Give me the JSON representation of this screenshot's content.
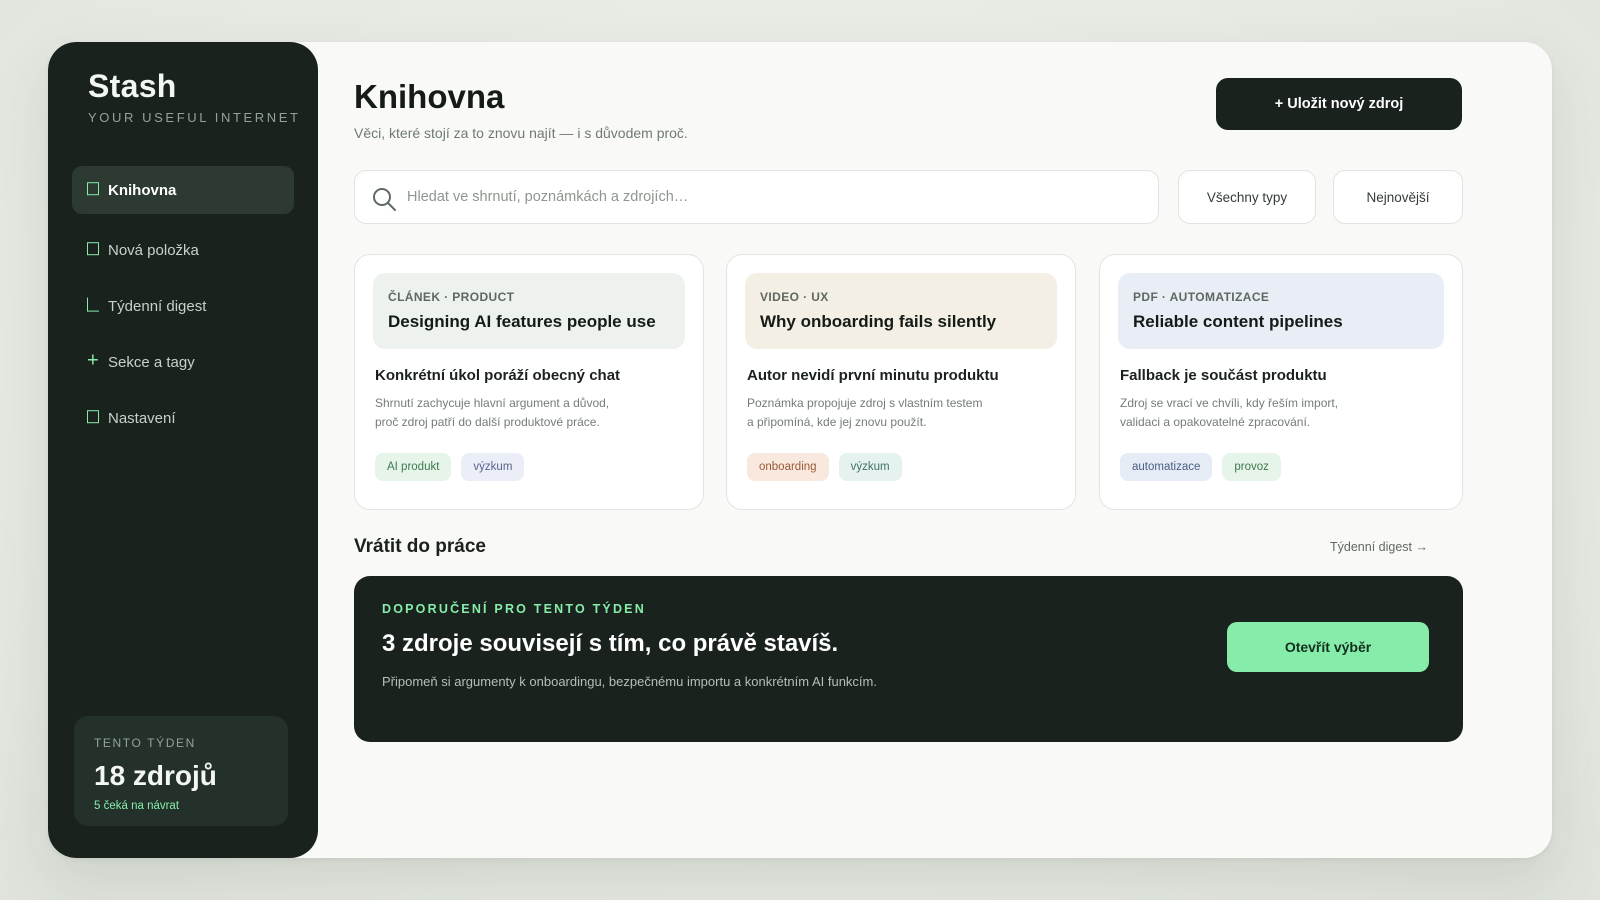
{
  "colors": {
    "accent": "#86ecaa",
    "sidebar_bg": "#1a221e",
    "page_bg": "#f9faf8"
  },
  "sidebar": {
    "brand": "Stash",
    "tagline": "YOUR USEFUL INTERNET",
    "items": [
      {
        "label": "Knihovna",
        "icon": "square-icon",
        "active": true
      },
      {
        "label": "Nová položka",
        "icon": "square-icon",
        "active": false
      },
      {
        "label": "Týdenní digest",
        "icon": "corner-icon",
        "active": false
      },
      {
        "label": "Sekce a tagy",
        "icon": "plus-icon",
        "active": false
      },
      {
        "label": "Nastavení",
        "icon": "square-icon",
        "active": false
      }
    ],
    "week": {
      "label": "TENTO TÝDEN",
      "count": "18 zdrojů",
      "sub": "5 čeká na návrat"
    }
  },
  "header": {
    "title": "Knihovna",
    "subtitle": "Věci, které stojí za to znovu najít — i s důvodem proč.",
    "primary_button": "+ Uložit nový zdroj"
  },
  "search": {
    "placeholder": "Hledat ve shrnutí, poznámkách a zdrojích…",
    "value": "",
    "icon": "search-icon"
  },
  "filters": {
    "type_label": "Všechny typy",
    "sort_label": "Nejnovější"
  },
  "cards": [
    {
      "kicker": "ČLÁNEK · PRODUCT",
      "title": "Designing AI features people use",
      "heading": "Konkrétní úkol poráží obecný chat",
      "body_line1": "Shrnutí zachycuje hlavní argument a důvod,",
      "body_line2": "proč zdroj patří do další produktové práce.",
      "tags": [
        "AI produkt",
        "výzkum"
      ],
      "head_bg": "#eef2ee"
    },
    {
      "kicker": "VIDEO · UX",
      "title": "Why onboarding fails silently",
      "heading": "Autor nevidí první minutu produktu",
      "body_line1": "Poznámka propojuje zdroj s vlastním testem",
      "body_line2": "a připomíná, kde jej znovu použít.",
      "tags": [
        "onboarding",
        "výzkum"
      ],
      "head_bg": "#f3efe4"
    },
    {
      "kicker": "PDF · AUTOMATIZACE",
      "title": "Reliable content pipelines",
      "heading": "Fallback je součást produktu",
      "body_line1": "Zdroj se vrací ve chvíli, kdy řeším import,",
      "body_line2": "validaci a opakovatelné zpracování.",
      "tags": [
        "automatizace",
        "provoz"
      ],
      "head_bg": "#e9eef6"
    }
  ],
  "section": {
    "title": "Vrátit do práce",
    "link": "Týdenní digest →"
  },
  "banner": {
    "kicker": "DOPORUČENÍ PRO TENTO TÝDEN",
    "title": "3 zdroje souvisejí s tím, co právě stavíš.",
    "subtitle": "Připomeň si argumenty k onboardingu, bezpečnému importu a konkrétním AI funkcím.",
    "button": "Otevřít výběr"
  }
}
